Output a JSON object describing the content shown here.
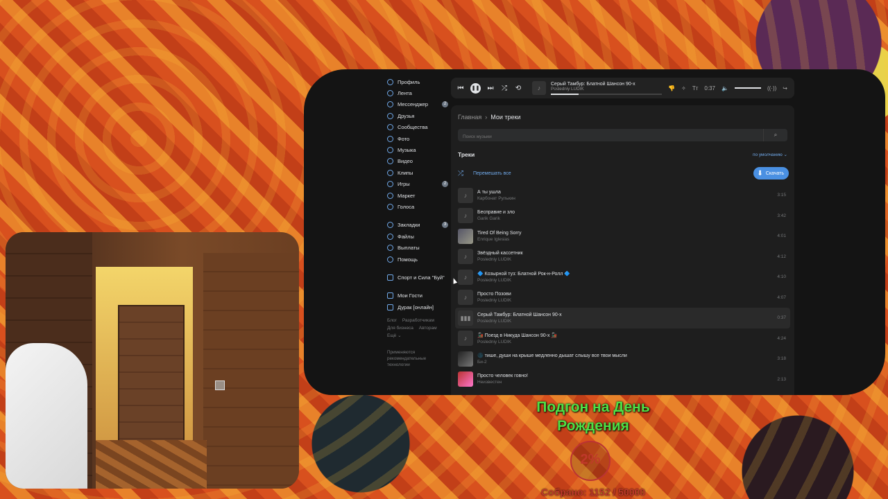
{
  "sidebar": {
    "items": [
      {
        "label": "Профиль",
        "icon": "profile-icon",
        "badge": ""
      },
      {
        "label": "Лента",
        "icon": "feed-icon",
        "badge": ""
      },
      {
        "label": "Мессенджер",
        "icon": "messenger-icon",
        "badge": "2"
      },
      {
        "label": "Друзья",
        "icon": "friends-icon",
        "badge": ""
      },
      {
        "label": "Сообщества",
        "icon": "communities-icon",
        "badge": ""
      },
      {
        "label": "Фото",
        "icon": "photo-icon",
        "badge": ""
      },
      {
        "label": "Музыка",
        "icon": "music-icon",
        "badge": ""
      },
      {
        "label": "Видео",
        "icon": "video-icon",
        "badge": ""
      },
      {
        "label": "Клипы",
        "icon": "clips-icon",
        "badge": ""
      },
      {
        "label": "Игры",
        "icon": "games-icon",
        "badge": "2"
      },
      {
        "label": "Маркет",
        "icon": "market-icon",
        "badge": ""
      },
      {
        "label": "Голоса",
        "icon": "votes-icon",
        "badge": ""
      }
    ],
    "items2": [
      {
        "label": "Закладки",
        "icon": "bookmarks-icon",
        "badge": "3"
      },
      {
        "label": "Файлы",
        "icon": "files-icon",
        "badge": ""
      },
      {
        "label": "Выплаты",
        "icon": "payments-icon",
        "badge": ""
      },
      {
        "label": "Помощь",
        "icon": "help-icon",
        "badge": ""
      }
    ],
    "group": "Спорт и Сила \"Буй\"",
    "apps": [
      "Мои Гости",
      "Дурак [онлайн]"
    ],
    "footer": [
      "Блог",
      "Разработчикам",
      "Для бизнеса",
      "Авторам",
      "Ещё ⌄"
    ],
    "recommend": "Применяются рекомендательные технологии"
  },
  "player": {
    "title": "Серый Тамбур: Блатной Шансон 90-х",
    "artist": "Posledniy LUDIK",
    "time": "0:37"
  },
  "breadcrumb": {
    "home": "Главная",
    "separator": "›",
    "current": "Мои треки"
  },
  "search": {
    "placeholder": "Поиск музыки"
  },
  "section": {
    "title": "Треки",
    "sort": "по умолчанию ⌄"
  },
  "shuffle_label": "Перемешать все",
  "download_label": "Скачать",
  "tracks": [
    {
      "title": "А ты ушла",
      "artist": "Карбонат Рулькин",
      "duration": "3:15"
    },
    {
      "title": "Бесправие и зло",
      "artist": "Garik Garik",
      "duration": "3:42"
    },
    {
      "title": "Tired Of Being Sorry",
      "artist": "Enrique Iglesias",
      "duration": "4:01"
    },
    {
      "title": "Звёздный кассетник",
      "artist": "Posledniy LUDIK",
      "duration": "4:12"
    },
    {
      "title": "🔷 Козырной туз: Блатной Рок-н-Ролл 🔷",
      "artist": "Posledniy LUDIK",
      "duration": "4:10"
    },
    {
      "title": "Просто Позови",
      "artist": "Posledniy LUDIK",
      "duration": "4:07"
    },
    {
      "title": "Серый Тамбур: Блатной Шансон 90-х",
      "artist": "Posledniy LUDIK",
      "duration": "0:37"
    },
    {
      "title": "🚂 Поезд в Никуда Шансон 90-х 🚂",
      "artist": "Posledniy LUDIK",
      "duration": "4:24"
    },
    {
      "title": "🌑 тише, души на крыше медленно дышат слышу все твои мысли",
      "artist": "Би-2",
      "duration": "3:18"
    },
    {
      "title": "Просто человек говно!",
      "artist": "Неизвестен",
      "duration": "2:13"
    }
  ],
  "goal": {
    "title_line1": "Подгон на День",
    "title_line2": "Рождения",
    "percent": "2%",
    "collected": "Собрано: 1152 / 50000"
  }
}
